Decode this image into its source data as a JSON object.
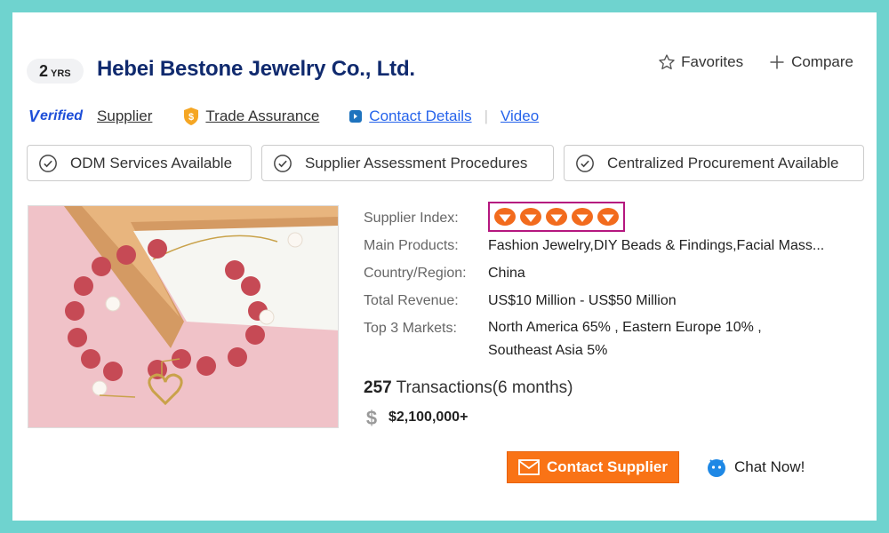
{
  "supplier": {
    "years_num": "2",
    "years_unit": "YRS",
    "company_name": "Hebei Bestone Jewelry Co., Ltd."
  },
  "actions": {
    "favorites": "Favorites",
    "compare": "Compare"
  },
  "links": {
    "verified_badge": "erified",
    "verified_v": "V",
    "supplier": "Supplier",
    "trade_assurance": "Trade Assurance",
    "contact_details": "Contact Details",
    "video": "Video"
  },
  "chips": [
    {
      "label": "ODM Services Available"
    },
    {
      "label": "Supplier Assessment Procedures"
    },
    {
      "label": "Centralized Procurement Available"
    }
  ],
  "details": {
    "supplier_index_label": "Supplier Index:",
    "supplier_index_diamonds": 5,
    "main_products_label": "Main Products:",
    "main_products": "Fashion Jewelry,DIY Beads & Findings,Facial Mass...",
    "country_label": "Country/Region:",
    "country": "China",
    "revenue_label": "Total Revenue:",
    "revenue": "US$10 Million - US$50 Million",
    "markets_label": "Top 3 Markets:",
    "markets_line1": "North America 65% , Eastern Europe 10% ,",
    "markets_line2": "Southeast Asia 5%"
  },
  "stats": {
    "transactions_count": "257",
    "transactions_text": " Transactions(6 months)",
    "amount": "$2,100,000+"
  },
  "buttons": {
    "contact_supplier": "Contact Supplier",
    "chat_now": "Chat Now!"
  },
  "colors": {
    "accent_orange": "#f97316",
    "title_navy": "#102a6e",
    "link_blue": "#2563eb",
    "highlight_magenta": "#b5177f",
    "background_teal": "#6fd3cf"
  }
}
